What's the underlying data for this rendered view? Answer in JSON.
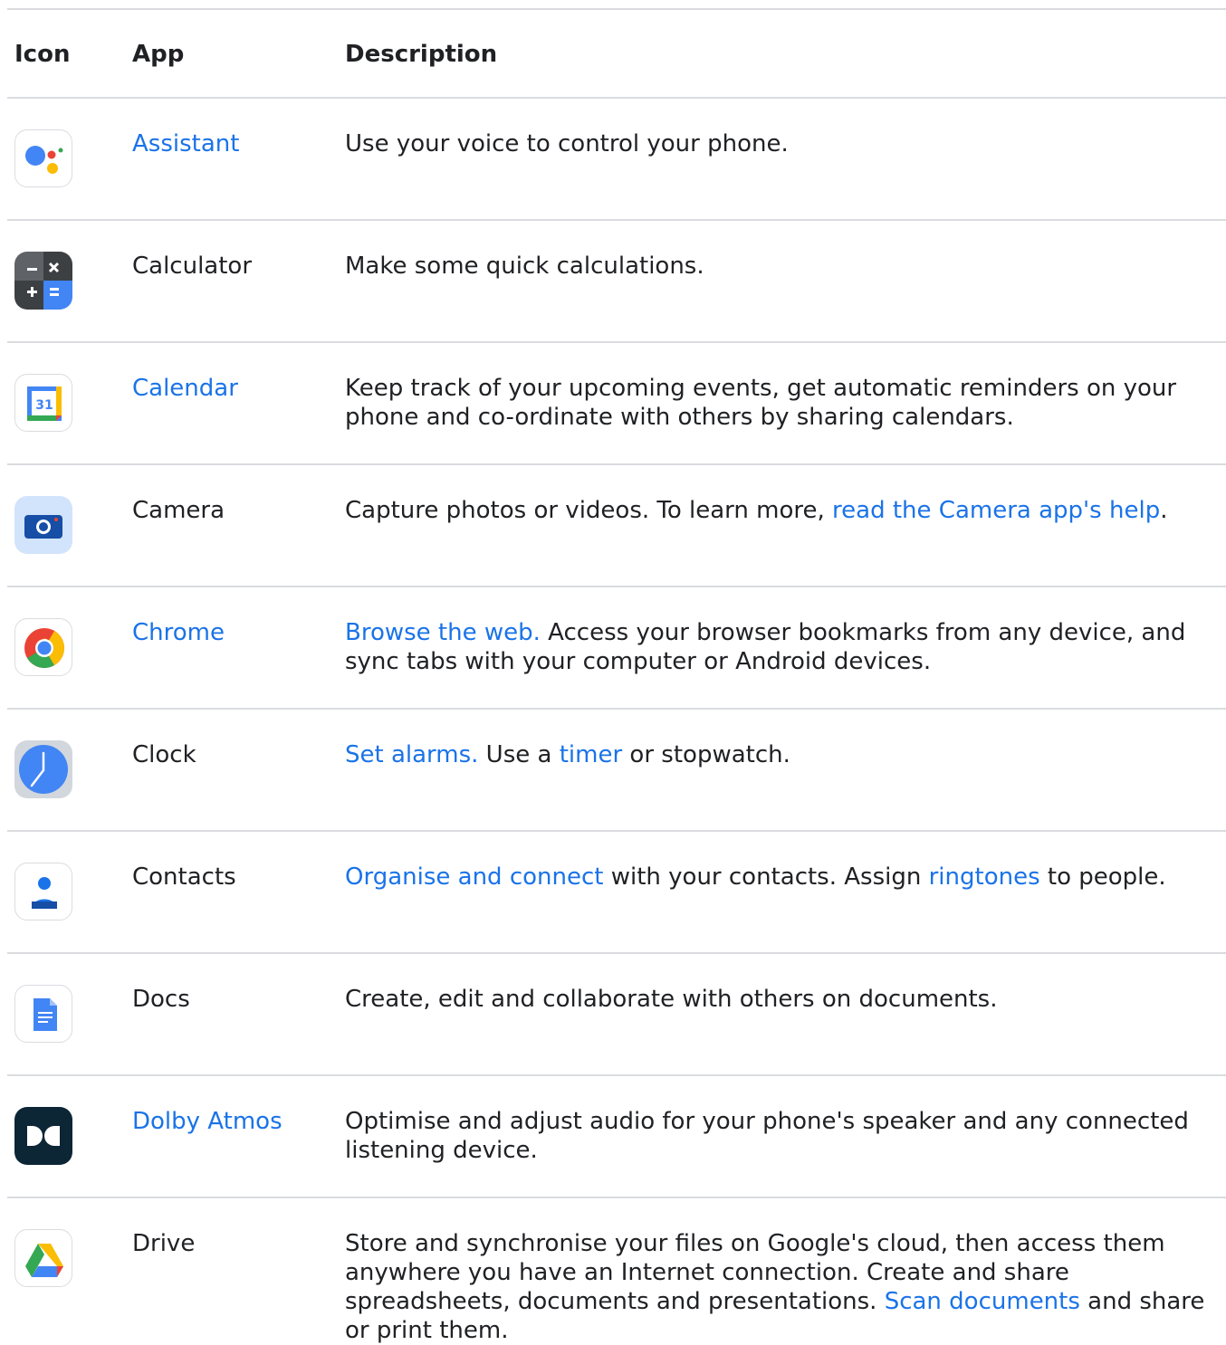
{
  "table": {
    "headers": {
      "icon": "Icon",
      "app": "App",
      "description": "Description"
    },
    "rows": [
      {
        "icon": "assistant-icon",
        "app": "Assistant",
        "app_link": true,
        "desc": [
          {
            "text": "Use your voice to control your phone.",
            "link": false
          }
        ]
      },
      {
        "icon": "calculator-icon",
        "app": "Calculator",
        "app_link": false,
        "desc": [
          {
            "text": "Make some quick calculations.",
            "link": false
          }
        ]
      },
      {
        "icon": "calendar-icon",
        "app": "Calendar",
        "app_link": true,
        "desc": [
          {
            "text": "Keep track of your upcoming events, get automatic reminders on your phone and co-ordinate with others by sharing calendars.",
            "link": false
          }
        ]
      },
      {
        "icon": "camera-icon",
        "app": "Camera",
        "app_link": false,
        "desc": [
          {
            "text": "Capture photos or videos. To learn more, ",
            "link": false
          },
          {
            "text": "read the Camera app's help",
            "link": true
          },
          {
            "text": ".",
            "link": false
          }
        ]
      },
      {
        "icon": "chrome-icon",
        "app": "Chrome",
        "app_link": true,
        "desc": [
          {
            "text": "Browse the web.",
            "link": true
          },
          {
            "text": " Access your browser bookmarks from any device, and sync tabs with your computer or Android devices.",
            "link": false
          }
        ]
      },
      {
        "icon": "clock-icon",
        "app": "Clock",
        "app_link": false,
        "desc": [
          {
            "text": "Set alarms.",
            "link": true
          },
          {
            "text": " Use a ",
            "link": false
          },
          {
            "text": "timer",
            "link": true
          },
          {
            "text": " or stopwatch.",
            "link": false
          }
        ]
      },
      {
        "icon": "contacts-icon",
        "app": "Contacts",
        "app_link": false,
        "desc": [
          {
            "text": "Organise and connect",
            "link": true
          },
          {
            "text": " with your contacts. Assign ",
            "link": false
          },
          {
            "text": "ringtones",
            "link": true
          },
          {
            "text": " to people.",
            "link": false
          }
        ]
      },
      {
        "icon": "docs-icon",
        "app": "Docs",
        "app_link": false,
        "desc": [
          {
            "text": "Create, edit and collaborate with others on documents.",
            "link": false
          }
        ]
      },
      {
        "icon": "dolby-atmos-icon",
        "app": "Dolby Atmos",
        "app_link": true,
        "desc": [
          {
            "text": "Optimise and adjust audio for your phone's speaker and any connected listening device.",
            "link": false
          }
        ]
      },
      {
        "icon": "drive-icon",
        "app": "Drive",
        "app_link": false,
        "desc": [
          {
            "text": "Store and synchronise your files on Google's cloud, then access them anywhere you have an Internet connection. Create and share spreadsheets, documents and presentations. ",
            "link": false
          },
          {
            "text": "Scan documents",
            "link": true
          },
          {
            "text": " and share or print them.",
            "link": false
          }
        ]
      }
    ]
  },
  "colors": {
    "link": "#1a73e8",
    "text": "#202124",
    "divider": "#dadce0"
  }
}
